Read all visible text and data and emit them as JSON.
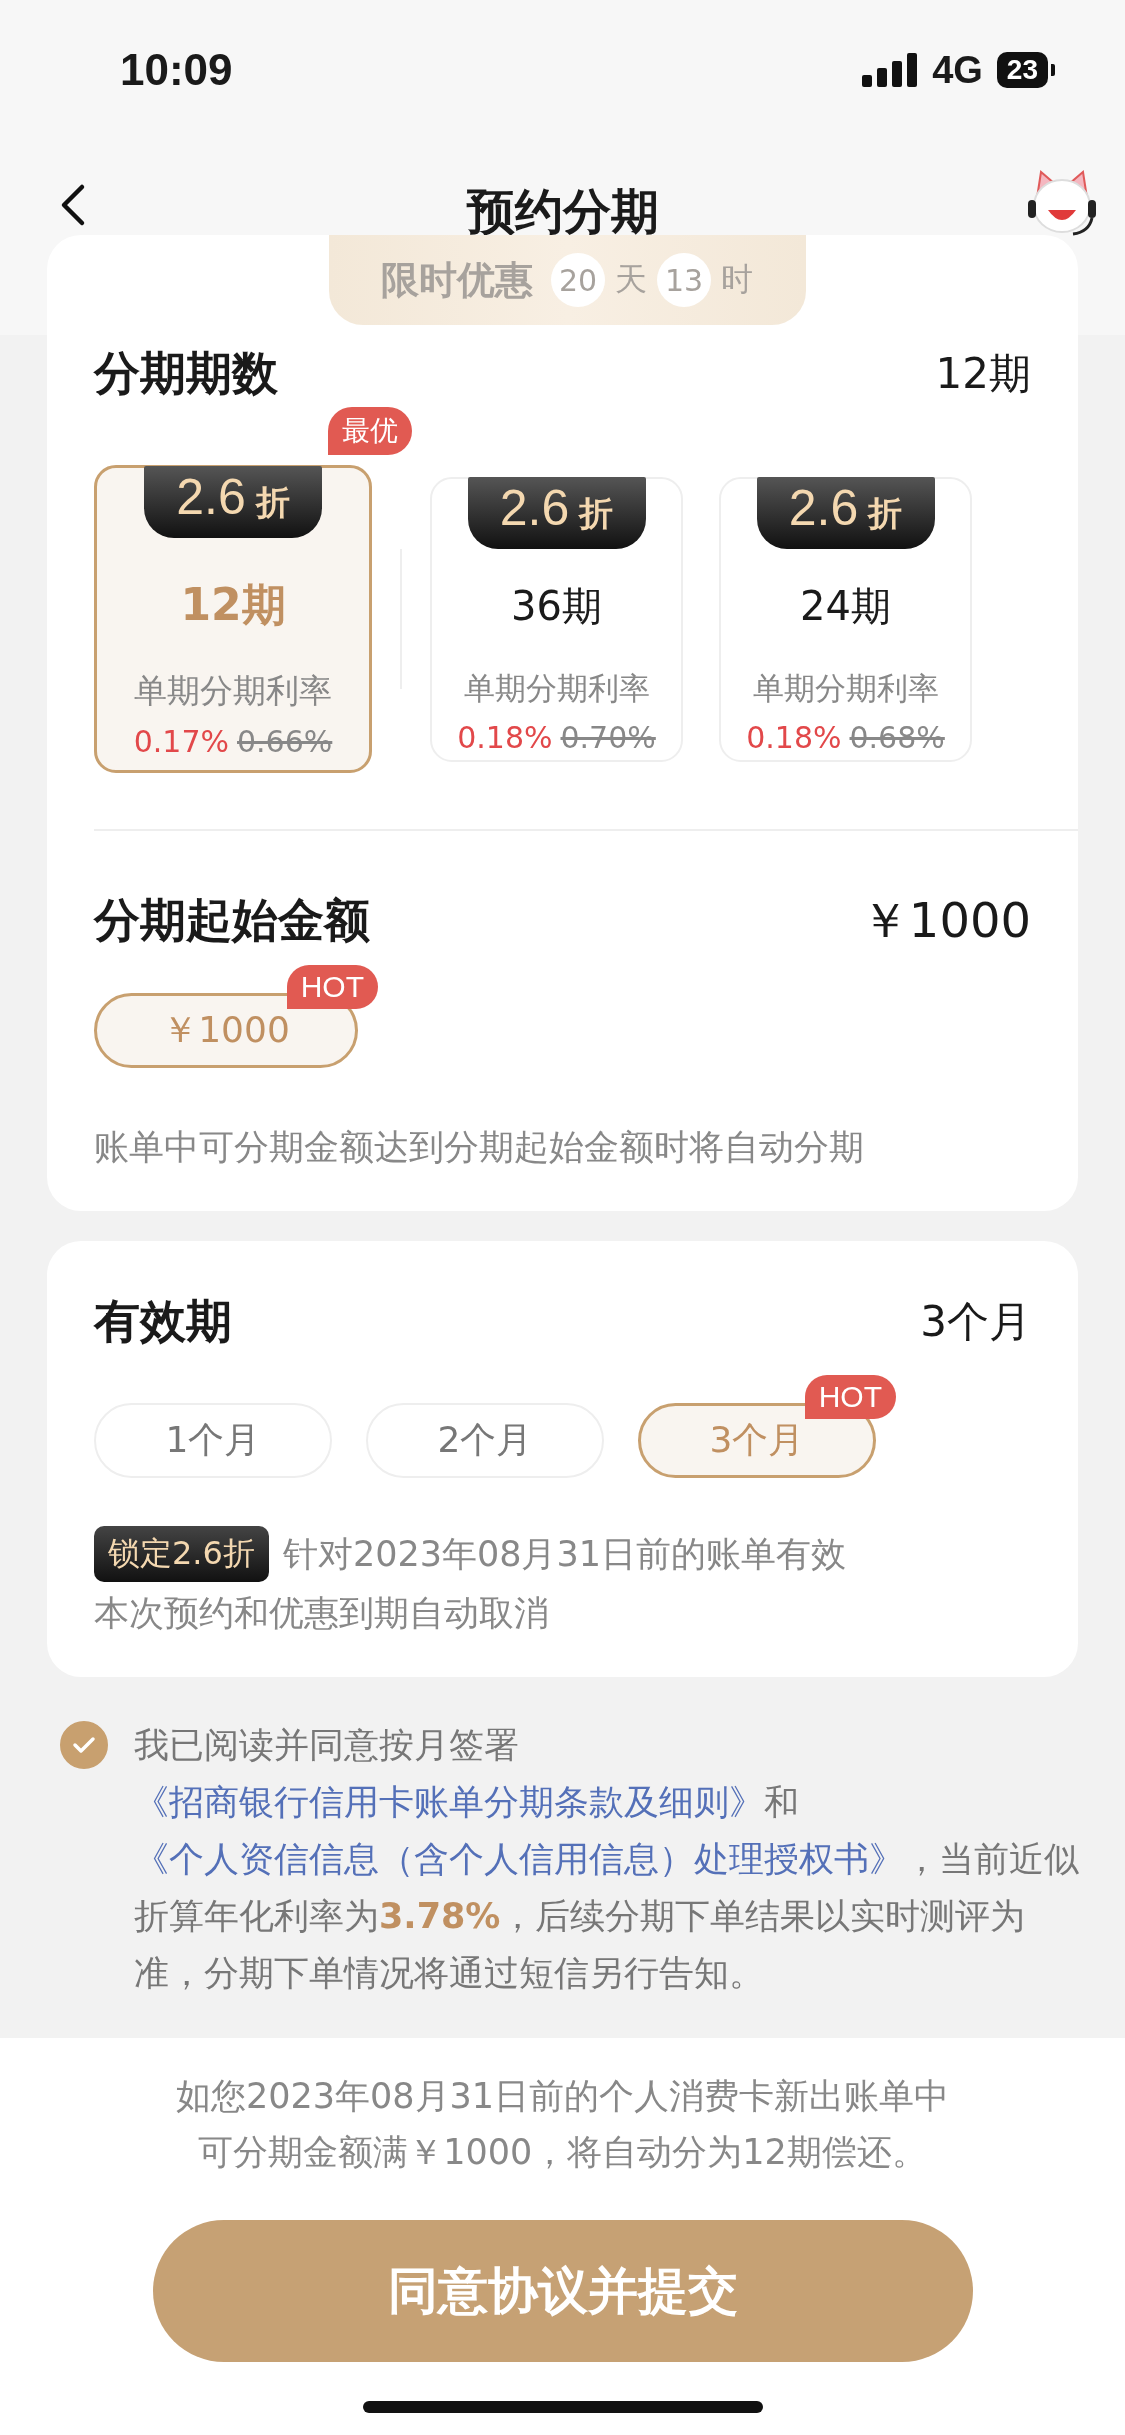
{
  "status_bar": {
    "time": "10:09",
    "network": "4G",
    "battery": "23"
  },
  "nav": {
    "title": "预约分期"
  },
  "promo": {
    "label": "限时优惠",
    "days": "20",
    "day_unit": "天",
    "hours": "13",
    "hour_unit": "时"
  },
  "terms": {
    "title": "分期期数",
    "value": "12期",
    "options": [
      {
        "discount": "2.6",
        "discount_unit": "折",
        "term": "12期",
        "rate_label": "单期分期利率",
        "rate": "0.17%",
        "original_rate": "0.66%",
        "selected": true,
        "badge": "最优"
      },
      {
        "discount": "2.6",
        "discount_unit": "折",
        "term": "36期",
        "rate_label": "单期分期利率",
        "rate": "0.18%",
        "original_rate": "0.70%",
        "selected": false
      },
      {
        "discount": "2.6",
        "discount_unit": "折",
        "term": "24期",
        "rate_label": "单期分期利率",
        "rate": "0.18%",
        "original_rate": "0.68%",
        "selected": false
      }
    ]
  },
  "amount": {
    "title": "分期起始金额",
    "value": "￥1000",
    "options": [
      {
        "label": "￥1000",
        "selected": true,
        "badge": "HOT"
      }
    ],
    "hint": "账单中可分期金额达到分期起始金额时将自动分期"
  },
  "validity": {
    "title": "有效期",
    "value": "3个月",
    "options": [
      {
        "label": "1个月",
        "selected": false
      },
      {
        "label": "2个月",
        "selected": false
      },
      {
        "label": "3个月",
        "selected": true,
        "badge": "HOT"
      }
    ],
    "lock_tag": "锁定2.6折",
    "note_1": "针对2023年08月31日前的账单有效",
    "note_2": "本次预约和优惠到期自动取消"
  },
  "agreement": {
    "checked": true,
    "segments": [
      {
        "kind": "text",
        "text": "我已阅读并同意按月签署"
      },
      {
        "kind": "link",
        "text": "《招商银行信用卡账单分期条款及细则》"
      },
      {
        "kind": "text",
        "text": "和"
      },
      {
        "kind": "link",
        "text": "《个人资信信息（含个人信用信息）处理授权书》"
      },
      {
        "kind": "text",
        "text": "，当前近似折算年化利率为"
      },
      {
        "kind": "highlight",
        "text": "3.78%"
      },
      {
        "kind": "text",
        "text": "，后续分期下单结果以实时测评为准，分期下单情况将通过短信另行告知。"
      }
    ]
  },
  "footer": {
    "note_1": "如您2023年08月31日前的个人消费卡新出账单中",
    "note_2": "可分期金额满￥1000，将自动分为12期偿还。",
    "button": "同意协议并提交"
  }
}
